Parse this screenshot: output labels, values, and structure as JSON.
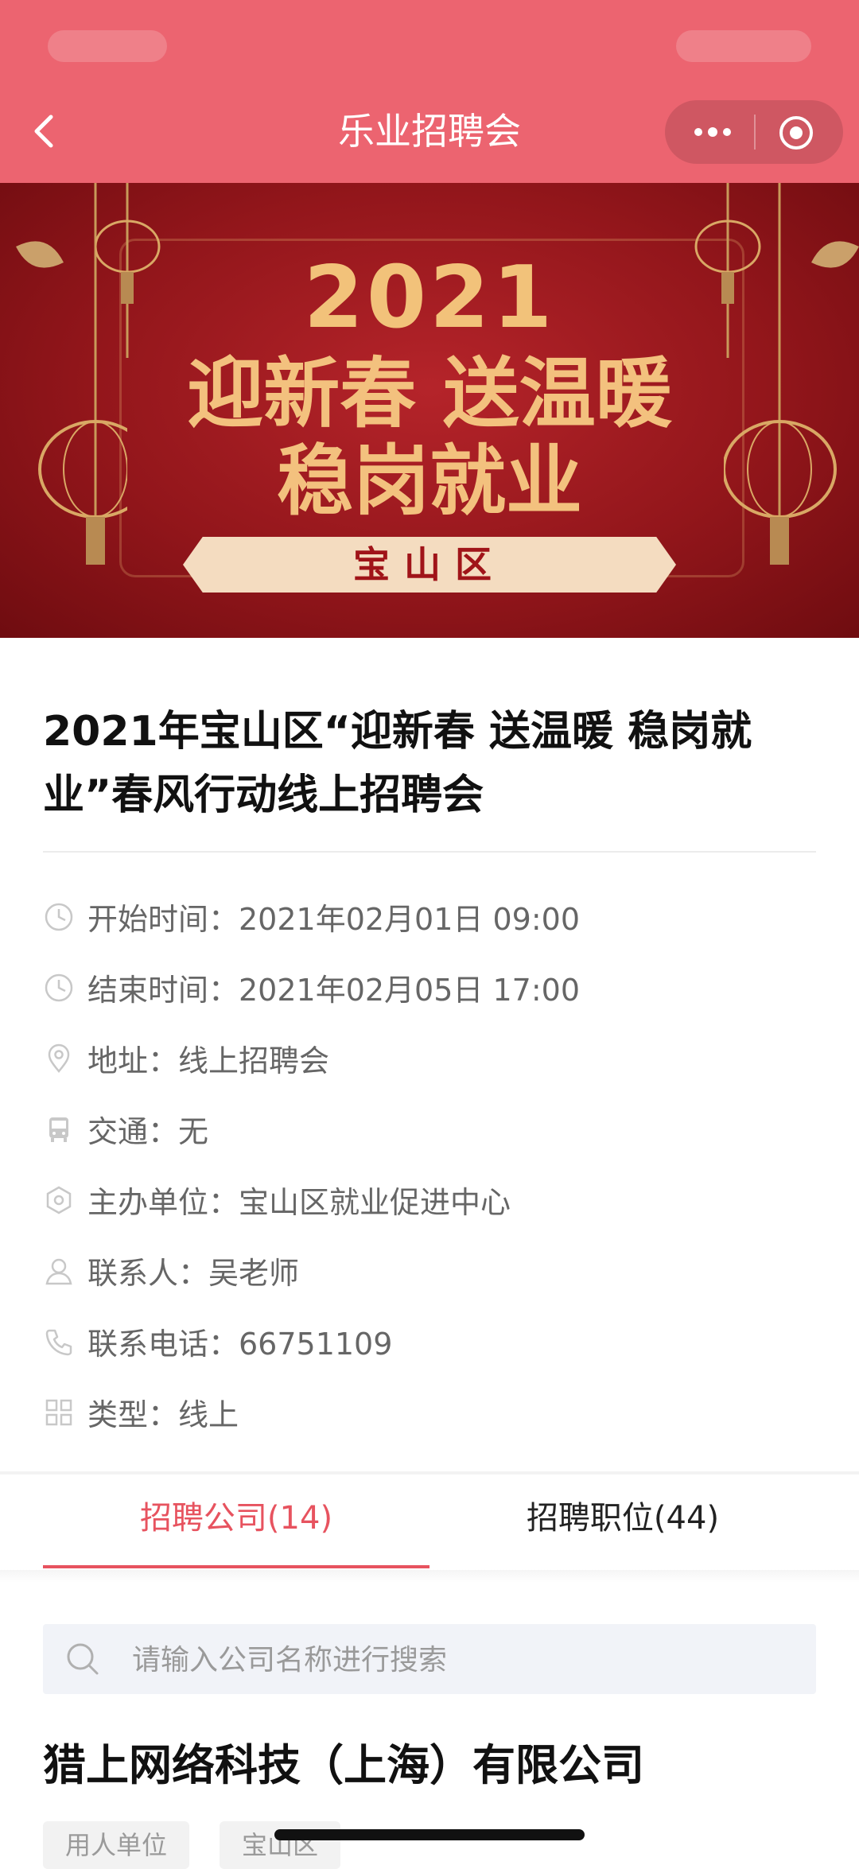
{
  "header": {
    "title": "乐业招聘会",
    "bg_color": "#ec6470"
  },
  "banner": {
    "year": "2021",
    "line1": "迎新春 送温暖",
    "line2": "稳岗就业",
    "district": "宝山区"
  },
  "event": {
    "title": "2021年宝山区“迎新春 送温暖 稳岗就业”春风行动线上招聘会",
    "info": [
      {
        "icon": "clock-icon",
        "text": "开始时间：2021年02月01日 09:00"
      },
      {
        "icon": "clock-icon",
        "text": "结束时间：2021年02月05日 17:00"
      },
      {
        "icon": "location-pin-icon",
        "text": "地址：线上招聘会"
      },
      {
        "icon": "bus-icon",
        "text": "交通：无"
      },
      {
        "icon": "hexagon-icon",
        "text": "主办单位：宝山区就业促进中心"
      },
      {
        "icon": "person-icon",
        "text": "联系人：吴老师"
      },
      {
        "icon": "phone-icon",
        "text": "联系电话：66751109"
      },
      {
        "icon": "grid-icon",
        "text": "类型：线上"
      }
    ]
  },
  "tabs": {
    "companies": "招聘公司(14)",
    "positions": "招聘职位(44)",
    "active_color": "#e7535f"
  },
  "search": {
    "placeholder": "请输入公司名称进行搜索"
  },
  "company": {
    "name": "猎上网络科技（上海）有限公司",
    "tags": [
      "用人单位",
      "宝山区"
    ]
  }
}
